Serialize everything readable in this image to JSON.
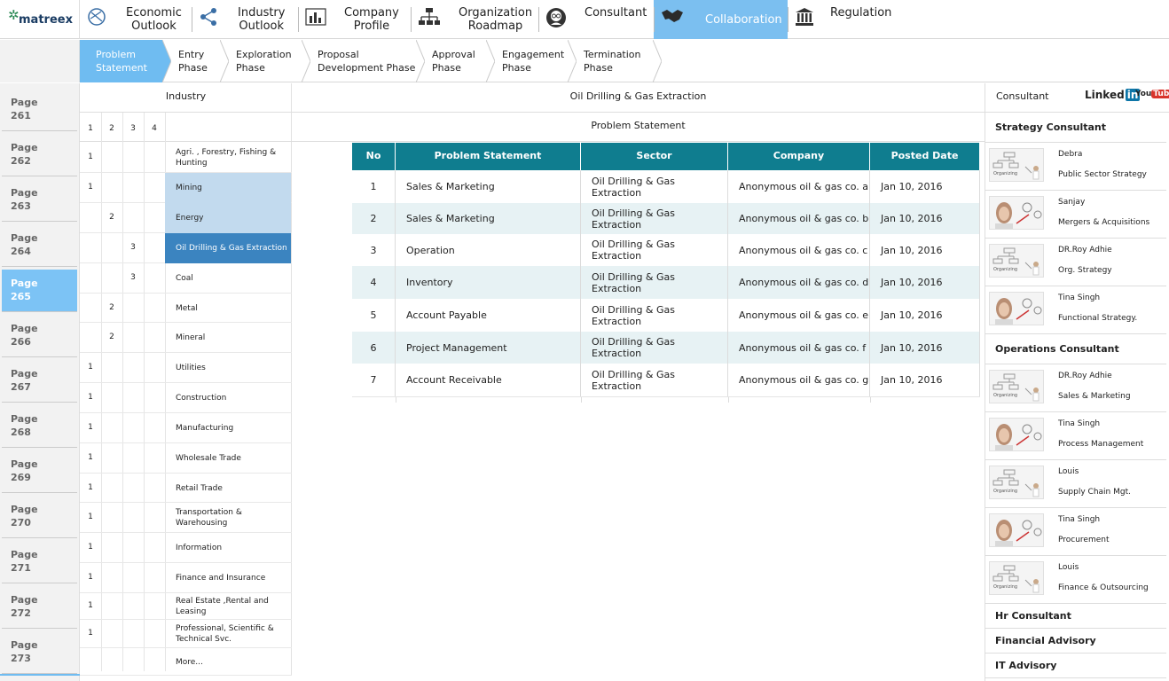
{
  "app": {
    "logo_text": "matreex"
  },
  "nav": [
    {
      "label": "Economic\nOutlook",
      "icon": "globe-icon"
    },
    {
      "label": "Industry\nOutlook",
      "icon": "share-icon"
    },
    {
      "label": "Company\nProfile",
      "icon": "bar-chart-icon"
    },
    {
      "label": "Organization\nRoadmap",
      "icon": "org-chart-icon"
    },
    {
      "label": "Consultant",
      "icon": "consultant-icon"
    },
    {
      "label": "Collaboration",
      "icon": "handshake-icon",
      "active": true
    },
    {
      "label": "Regulation",
      "icon": "building-icon"
    }
  ],
  "phases": [
    {
      "label": "Problem\nStatement",
      "active": true
    },
    {
      "label": "Entry\nPhase"
    },
    {
      "label": "Exploration\nPhase"
    },
    {
      "label": "Proposal\nDevelopment Phase"
    },
    {
      "label": "Approval\nPhase"
    },
    {
      "label": "Engagement\nPhase"
    },
    {
      "label": "Termination\nPhase"
    }
  ],
  "pages": [
    {
      "label": "Page\n261"
    },
    {
      "label": "Page\n262"
    },
    {
      "label": "Page\n263"
    },
    {
      "label": "Page\n264"
    },
    {
      "label": "Page\n265",
      "active": true
    },
    {
      "label": "Page\n266"
    },
    {
      "label": "Page\n267"
    },
    {
      "label": "Page\n268"
    },
    {
      "label": "Page\n269"
    },
    {
      "label": "Page\n270"
    },
    {
      "label": "Page\n271"
    },
    {
      "label": "Page\n272"
    },
    {
      "label": "Page\n273"
    }
  ],
  "industry": {
    "header": "Industry",
    "levels": [
      "1",
      "2",
      "3",
      "4"
    ],
    "rows": [
      {
        "name": "Agri. , Forestry, Fishing & Hunting",
        "level": 1,
        "value": "1"
      },
      {
        "name": "Mining",
        "level": 1,
        "value": "1",
        "state": "hl"
      },
      {
        "name": "Energy",
        "level": 2,
        "value": "2",
        "state": "hl"
      },
      {
        "name": "Oil Drilling & Gas Extraction",
        "level": 3,
        "value": "3",
        "state": "sel"
      },
      {
        "name": "Coal",
        "level": 3,
        "value": "3"
      },
      {
        "name": "Metal",
        "level": 2,
        "value": "2"
      },
      {
        "name": "Mineral",
        "level": 2,
        "value": "2"
      },
      {
        "name": "Utilities",
        "level": 1,
        "value": "1"
      },
      {
        "name": "Construction",
        "level": 1,
        "value": "1"
      },
      {
        "name": "Manufacturing",
        "level": 1,
        "value": "1"
      },
      {
        "name": "Wholesale Trade",
        "level": 1,
        "value": "1"
      },
      {
        "name": "Retail Trade",
        "level": 1,
        "value": "1"
      },
      {
        "name": "Transportation & Warehousing",
        "level": 1,
        "value": "1"
      },
      {
        "name": "Information",
        "level": 1,
        "value": "1"
      },
      {
        "name": "Finance and Insurance",
        "level": 1,
        "value": "1"
      },
      {
        "name": "Real Estate ,Rental and Leasing",
        "level": 1,
        "value": "1"
      },
      {
        "name": "Professional, Scientific & Technical  Svc.",
        "level": 1,
        "value": "1"
      },
      {
        "name": "More...",
        "level": 0,
        "value": ""
      }
    ]
  },
  "main": {
    "title": "Oil Drilling & Gas Extraction",
    "subtitle": "Problem Statement",
    "columns": [
      "No",
      "Problem Statement",
      "Sector",
      "Company",
      "Posted Date"
    ],
    "rows": [
      [
        "1",
        "Sales & Marketing",
        "Oil Drilling & Gas Extraction",
        "Anonymous oil & gas co. a",
        "Jan 10, 2016"
      ],
      [
        "2",
        "Sales & Marketing",
        "Oil Drilling & Gas Extraction",
        "Anonymous oil & gas co. b",
        "Jan 10, 2016"
      ],
      [
        "3",
        "Operation",
        "Oil Drilling & Gas Extraction",
        "Anonymous oil & gas co. c",
        "Jan 10, 2016"
      ],
      [
        "4",
        "Inventory",
        "Oil Drilling & Gas Extraction",
        "Anonymous oil & gas co. d",
        "Jan 10, 2016"
      ],
      [
        "5",
        "Account Payable",
        "Oil Drilling & Gas Extraction",
        "Anonymous oil & gas co. e",
        "Jan 10, 2016"
      ],
      [
        "6",
        "Project Management",
        "Oil Drilling & Gas Extraction",
        "Anonymous oil & gas co. f",
        "Jan 10, 2016"
      ],
      [
        "7",
        "Account Receivable",
        "Oil Drilling & Gas Extraction",
        "Anonymous oil & gas co. g",
        "Jan 10, 2016"
      ]
    ]
  },
  "consultant": {
    "header": "Consultant",
    "linkedin": {
      "text": "Linked",
      "badge": "in"
    },
    "youtube": {
      "text": "You",
      "badge": "Tube"
    },
    "groups": [
      {
        "title": "Strategy Consultant",
        "people": [
          {
            "name": "Debra",
            "spec": "Public Sector Strategy",
            "thumb": "org"
          },
          {
            "name": "Sanjay",
            "spec": "Mergers & Acquisitions",
            "thumb": "woman"
          },
          {
            "name": "DR.Roy Adhie",
            "spec": "Org. Strategy",
            "thumb": "org"
          },
          {
            "name": "Tina Singh",
            "spec": "Functional Strategy.",
            "thumb": "woman"
          }
        ]
      },
      {
        "title": "Operations Consultant",
        "people": [
          {
            "name": "DR.Roy Adhie",
            "spec": "Sales & Marketing",
            "thumb": "org"
          },
          {
            "name": "Tina Singh",
            "spec": "Process Management",
            "thumb": "woman"
          },
          {
            "name": "Louis",
            "spec": "Supply Chain Mgt.",
            "thumb": "org"
          },
          {
            "name": "Tina Singh",
            "spec": "Procurement",
            "thumb": "woman"
          },
          {
            "name": "Louis",
            "spec": "Finance & Outsourcing",
            "thumb": "org"
          }
        ]
      },
      {
        "title": "Hr Consultant",
        "people": []
      },
      {
        "title": "Financial Advisory",
        "people": []
      },
      {
        "title": "IT Advisory",
        "people": []
      }
    ],
    "thumb_caption": "Organizing"
  },
  "colors": {
    "accent": "#7bbff0",
    "table_header": "#0f7d8f",
    "selected": "#3b84c0",
    "highlight": "#c2daee"
  }
}
